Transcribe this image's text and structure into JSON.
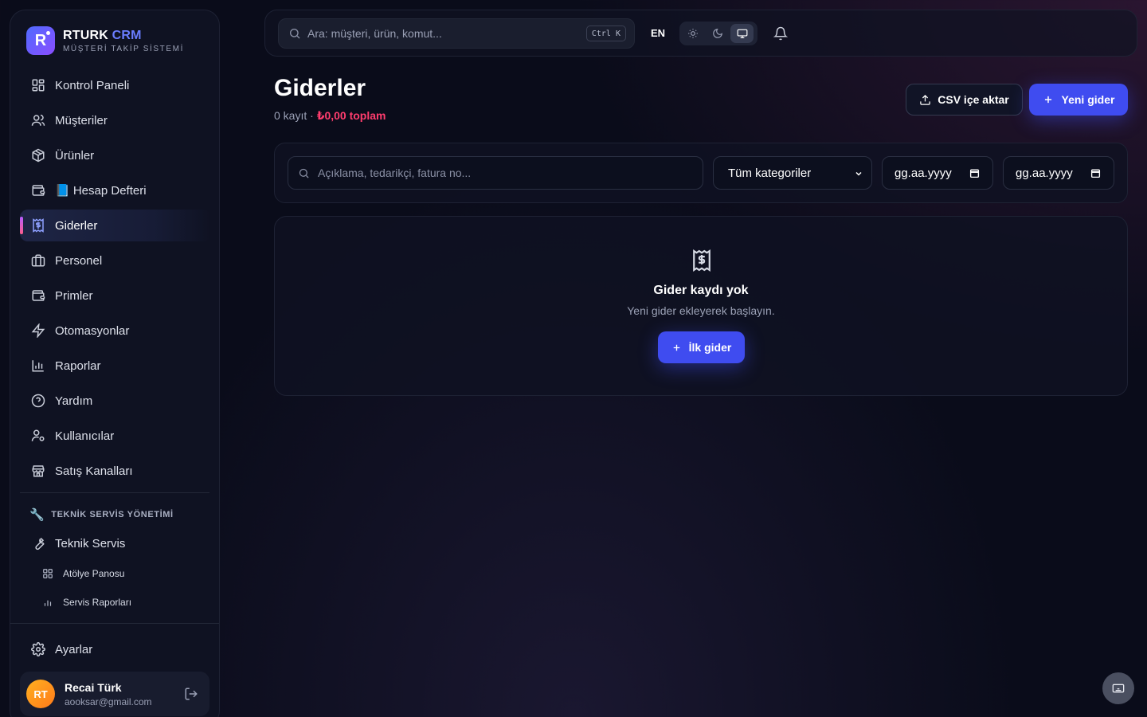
{
  "brand": {
    "name_main": "RTURK",
    "name_accent": "CRM",
    "subtitle": "MÜŞTERİ TAKİP SİSTEMİ",
    "logo_letter": "R"
  },
  "nav": {
    "items": [
      {
        "label": "Kontrol Paneli",
        "icon": "grid-icon"
      },
      {
        "label": "Müşteriler",
        "icon": "users-icon"
      },
      {
        "label": "Ürünler",
        "icon": "box-icon"
      },
      {
        "label": "📘 Hesap Defteri",
        "icon": "wallet-icon"
      },
      {
        "label": "Giderler",
        "icon": "receipt-dollar-icon",
        "active": true
      },
      {
        "label": "Personel",
        "icon": "briefcase-icon"
      },
      {
        "label": "Primler",
        "icon": "wallet-icon"
      },
      {
        "label": "Otomasyonlar",
        "icon": "lightning-icon"
      },
      {
        "label": "Raporlar",
        "icon": "bar-chart-icon"
      },
      {
        "label": "Yardım",
        "icon": "help-circle-icon"
      },
      {
        "label": "Kullanıcılar",
        "icon": "user-gear-icon"
      },
      {
        "label": "Satış Kanalları",
        "icon": "store-icon"
      }
    ],
    "section_title": "TEKNİK SERVİS YÖNETİMİ",
    "section_emoji": "🔧",
    "service_item": "Teknik Servis",
    "sub_items": [
      {
        "label": "Atölye Panosu",
        "icon": "grid-icon"
      },
      {
        "label": "Servis Raporları",
        "icon": "bar-chart-icon"
      }
    ],
    "settings": "Ayarlar"
  },
  "user": {
    "initials": "RT",
    "name": "Recai Türk",
    "email": "aooksar@gmail.com"
  },
  "topbar": {
    "search_placeholder": "Ara: müşteri, ürün, komut...",
    "shortcut": "Ctrl K",
    "language": "EN",
    "theme_active": "system"
  },
  "page": {
    "title": "Giderler",
    "record_count": "0 kayıt",
    "separator": " · ",
    "total": "₺0,00 toplam",
    "import_button": "CSV içe aktar",
    "new_button": "Yeni gider"
  },
  "filters": {
    "search_placeholder": "Açıklama, tedarikçi, fatura no...",
    "category_selected": "Tüm kategoriler",
    "date_from_placeholder": "gg.aa.yyyy",
    "date_to_placeholder": "gg.aa.yyyy"
  },
  "empty_state": {
    "title": "Gider kaydı yok",
    "description": "Yeni gider ekleyerek başlayın.",
    "button": "İlk gider"
  },
  "colors": {
    "accent": "#3f4cf0",
    "total_negative": "#ff3d6e",
    "background": "#0a0c1a"
  }
}
